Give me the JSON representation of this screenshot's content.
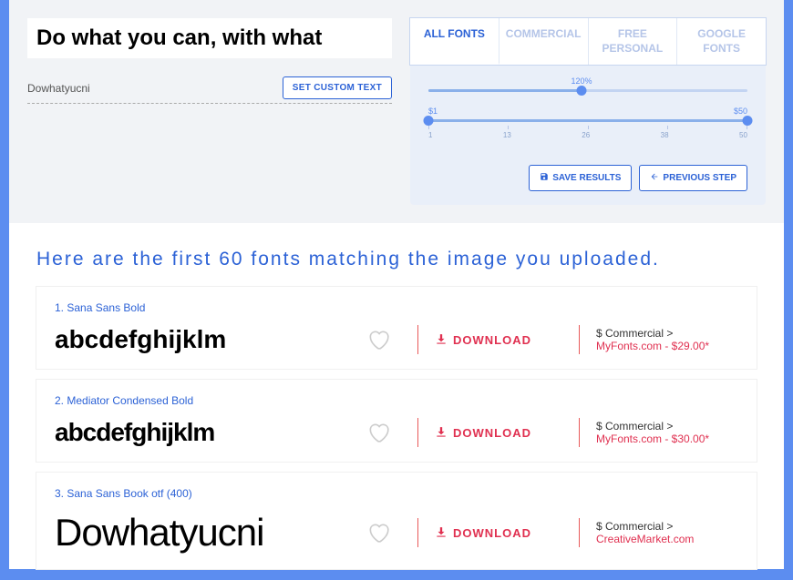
{
  "sample_text": "Do what you can, with what",
  "custom_input_value": "Dowhatyucni",
  "set_custom_btn": "SET CUSTOM TEXT",
  "tabs": [
    {
      "label": "ALL FONTS",
      "active": true
    },
    {
      "label": "COMMERCIAL",
      "active": false
    },
    {
      "label": "FREE PERSONAL",
      "active": false
    },
    {
      "label": "GOOGLE FONTS",
      "active": false
    }
  ],
  "zoom": {
    "value": "120%",
    "position": 48
  },
  "price": {
    "min": "$1",
    "max": "$50",
    "ticks": [
      "1",
      "13",
      "26",
      "38",
      "50"
    ]
  },
  "save_btn": "SAVE RESULTS",
  "prev_btn": "PREVIOUS STEP",
  "heading": "Here are the first 60 fonts matching the image you uploaded.",
  "download_label": "DOWNLOAD",
  "results": [
    {
      "idx": "1.",
      "name": "Sana Sans Bold",
      "preview": "abcdefghijklm",
      "commerce_prefix": "$ Commercial > ",
      "commerce_link": "MyFonts.com - $29.00*"
    },
    {
      "idx": "2.",
      "name": "Mediator Condensed Bold",
      "preview": "abcdefghijklm",
      "commerce_prefix": "$ Commercial > ",
      "commerce_link": "MyFonts.com - $30.00*"
    },
    {
      "idx": "3.",
      "name": "Sana Sans Book otf (400)",
      "preview": "Dowhatyucni",
      "commerce_prefix": "$ Commercial > ",
      "commerce_link": "CreativeMarket.com"
    }
  ]
}
